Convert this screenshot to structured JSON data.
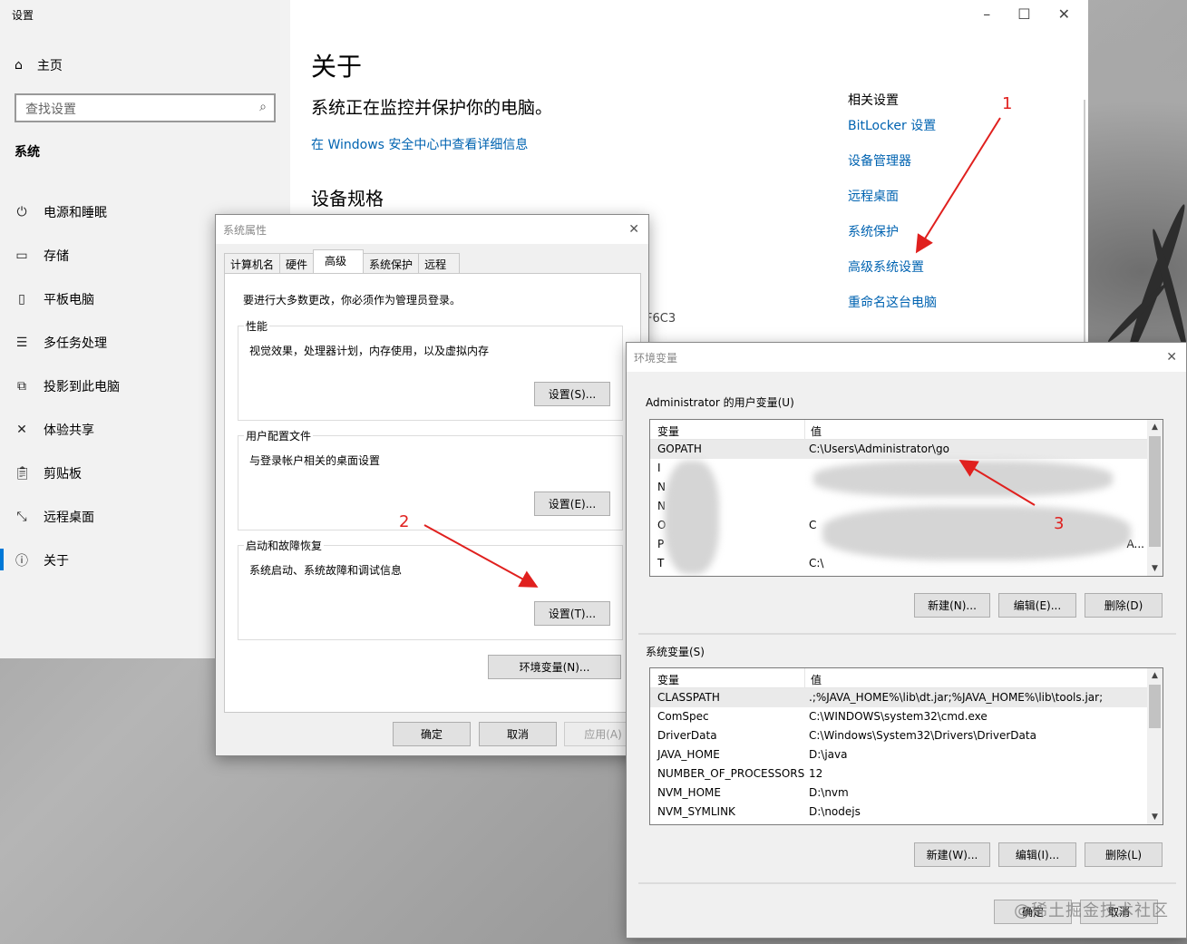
{
  "settings": {
    "window_title": "设置",
    "home_label": "主页",
    "search_placeholder": "查找设置",
    "section": "系统",
    "nav": [
      {
        "label": "电源和睡眠",
        "icon": "power-icon"
      },
      {
        "label": "存储",
        "icon": "storage-icon"
      },
      {
        "label": "平板电脑",
        "icon": "tablet-icon"
      },
      {
        "label": "多任务处理",
        "icon": "multitask-icon"
      },
      {
        "label": "投影到此电脑",
        "icon": "project-icon"
      },
      {
        "label": "体验共享",
        "icon": "share-icon"
      },
      {
        "label": "剪贴板",
        "icon": "clipboard-icon"
      },
      {
        "label": "远程桌面",
        "icon": "remote-icon"
      },
      {
        "label": "关于",
        "icon": "info-icon"
      }
    ],
    "about": {
      "title": "关于",
      "subtitle": "系统正在监控并保护你的电脑。",
      "link": "在 Windows 安全中心中查看详细信息",
      "spec_title": "设备规格",
      "fragment": "F6C3"
    },
    "related": {
      "title": "相关设置",
      "links": [
        "BitLocker 设置",
        "设备管理器",
        "远程桌面",
        "系统保护",
        "高级系统设置",
        "重命名这台电脑"
      ]
    }
  },
  "sysprops": {
    "title": "系统属性",
    "tabs": [
      "计算机名",
      "硬件",
      "高级",
      "系统保护",
      "远程"
    ],
    "admin_note": "要进行大多数更改，你必须作为管理员登录。",
    "groups": [
      {
        "label": "性能",
        "desc": "视觉效果，处理器计划，内存使用，以及虚拟内存",
        "button": "设置(S)..."
      },
      {
        "label": "用户配置文件",
        "desc": "与登录帐户相关的桌面设置",
        "button": "设置(E)..."
      },
      {
        "label": "启动和故障恢复",
        "desc": "系统启动、系统故障和调试信息",
        "button": "设置(T)..."
      }
    ],
    "env_button": "环境变量(N)...",
    "ok": "确定",
    "cancel": "取消",
    "apply": "应用(A)"
  },
  "envvars": {
    "title": "环境变量",
    "user_group": "Administrator 的用户变量(U)",
    "system_group": "系统变量(S)",
    "col_var": "变量",
    "col_val": "值",
    "user_rows": [
      {
        "name": "GOPATH",
        "value": "C:\\Users\\Administrator\\go"
      },
      {
        "name": "I",
        "value": ""
      },
      {
        "name": "N",
        "value": ""
      },
      {
        "name": "N",
        "value": ""
      },
      {
        "name": "O",
        "value": "C"
      },
      {
        "name": "P",
        "value": "A..."
      },
      {
        "name": "T",
        "value": "C:\\"
      }
    ],
    "user_buttons": [
      "新建(N)...",
      "编辑(E)...",
      "删除(D)"
    ],
    "system_rows": [
      {
        "name": "CLASSPATH",
        "value": ".;%JAVA_HOME%\\lib\\dt.jar;%JAVA_HOME%\\lib\\tools.jar;"
      },
      {
        "name": "ComSpec",
        "value": "C:\\WINDOWS\\system32\\cmd.exe"
      },
      {
        "name": "DriverData",
        "value": "C:\\Windows\\System32\\Drivers\\DriverData"
      },
      {
        "name": "JAVA_HOME",
        "value": "D:\\java"
      },
      {
        "name": "NUMBER_OF_PROCESSORS",
        "value": "12"
      },
      {
        "name": "NVM_HOME",
        "value": "D:\\nvm"
      },
      {
        "name": "NVM_SYMLINK",
        "value": "D:\\nodejs"
      }
    ],
    "system_buttons": [
      "新建(W)...",
      "编辑(I)...",
      "删除(L)"
    ],
    "ok": "确定",
    "cancel": "取消"
  },
  "annotations": [
    "1",
    "2",
    "3"
  ],
  "watermark": "@稀土掘金技术社区",
  "colors": {
    "link": "#0063b1",
    "accent": "#0078d7",
    "annotation": "#e0201e"
  }
}
